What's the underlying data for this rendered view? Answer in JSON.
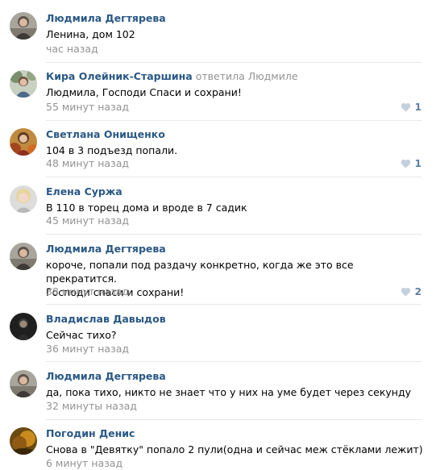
{
  "comments": [
    {
      "author": "Людмила Дегтярева",
      "reply_to": "",
      "text_lines": [
        "Ленина, дом 102"
      ],
      "time": "час назад",
      "likes": "",
      "avatar": "avatar-photo-lyudmila"
    },
    {
      "author": "Кира Олейник-Старшина",
      "reply_to": "ответила Людмиле",
      "text_lines": [
        "Людмила, Господи Спаси и сохрани!"
      ],
      "time": "55 минут назад",
      "likes": "1",
      "avatar": "avatar-photo-kira"
    },
    {
      "author": "Светлана Онищенко",
      "reply_to": "",
      "text_lines": [
        "104 в 3 подъезд попали."
      ],
      "time": "48 минут назад",
      "likes": "1",
      "avatar": "avatar-photo-svetlana"
    },
    {
      "author": "Елена Суржа",
      "reply_to": "",
      "text_lines": [
        "В 110 в торец дома и вроде в 7 садик"
      ],
      "time": "45 минут назад",
      "likes": "",
      "avatar": "avatar-photo-elena"
    },
    {
      "author": "Людмила Дегтярева",
      "reply_to": "",
      "text_lines": [
        "короче, попали под раздачу конкретно, когда же это все прекратится.",
        "Господи спаси и сохрани!"
      ],
      "time": "38 минут назад",
      "likes": "2",
      "avatar": "avatar-photo-lyudmila"
    },
    {
      "author": "Владислав Давыдов",
      "reply_to": "",
      "text_lines": [
        "Сейчас тихо?"
      ],
      "time": "36 минут назад",
      "likes": "",
      "avatar": "avatar-photo-vladislav"
    },
    {
      "author": "Людмила Дегтярева",
      "reply_to": "",
      "text_lines": [
        "да, пока тихо, никто не знает что у них на уме будет через секунду"
      ],
      "time": "32 минуты назад",
      "likes": "",
      "avatar": "avatar-photo-lyudmila"
    },
    {
      "author": "Погодин Денис",
      "reply_to": "",
      "text_lines": [
        "Снова в \"Девятку\" попало 2 пули(одна и сейчас меж стёклами лежит)"
      ],
      "time": "6 минут назад",
      "likes": "",
      "avatar": "avatar-photo-denis"
    }
  ],
  "icons": {
    "like": "heart-icon"
  },
  "colors": {
    "author": "#2a5885",
    "meta": "#939393",
    "like": "#5d7fa6",
    "divider": "#e7e8ec"
  }
}
